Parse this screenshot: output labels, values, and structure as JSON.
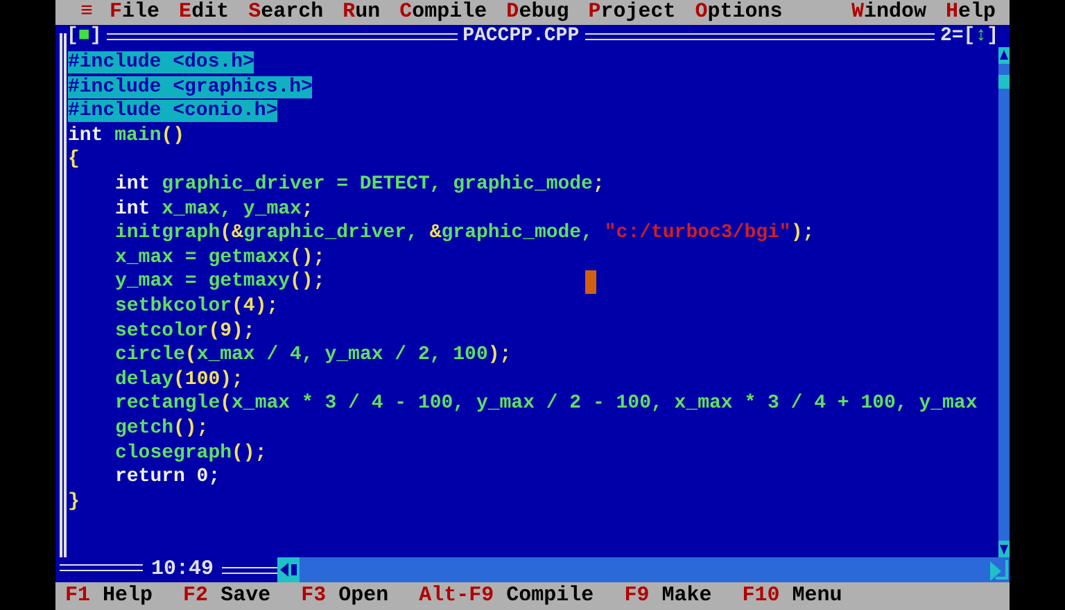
{
  "menu": {
    "system": "≡",
    "items": [
      {
        "label": "File"
      },
      {
        "label": "Edit"
      },
      {
        "label": "Search"
      },
      {
        "label": "Run"
      },
      {
        "label": "Compile"
      },
      {
        "label": "Debug"
      },
      {
        "label": "Project"
      },
      {
        "label": "Options"
      }
    ],
    "right_items": [
      {
        "label": "Window"
      },
      {
        "label": "Help"
      }
    ]
  },
  "editor": {
    "close_box": "[■]",
    "title": "PACCPP.CPP",
    "window_number": "2=",
    "zoom_box": "[↕]",
    "position": "10:49",
    "lines": [
      {
        "selected": true,
        "tokens": [
          {
            "kind": "selected",
            "text": "#include <dos.h>"
          }
        ]
      },
      {
        "selected": true,
        "tokens": [
          {
            "kind": "selected",
            "text": "#include <graphics.h>"
          }
        ]
      },
      {
        "selected": true,
        "tokens": [
          {
            "kind": "selected",
            "text": "#include <conio.h>"
          }
        ]
      },
      {
        "selected": false,
        "tokens": [
          {
            "kind": "keyword",
            "text": "int "
          },
          {
            "kind": "ident",
            "text": "main"
          },
          {
            "kind": "symbol",
            "text": "()"
          }
        ]
      },
      {
        "selected": false,
        "tokens": [
          {
            "kind": "symbol",
            "text": "{"
          }
        ],
        "children": [
          {
            "selected": false,
            "tokens": [
              {
                "kind": "keyword",
                "text": "int "
              },
              {
                "kind": "ident",
                "text": "graphic_driver = DETECT, graphic_mode"
              },
              {
                "kind": "symbol",
                "text": ";"
              }
            ]
          },
          {
            "selected": false,
            "tokens": [
              {
                "kind": "keyword",
                "text": "int "
              },
              {
                "kind": "ident",
                "text": "x_max, y_max"
              },
              {
                "kind": "symbol",
                "text": ";"
              }
            ]
          },
          {
            "selected": false,
            "tokens": [
              {
                "kind": "ident",
                "text": "initgraph"
              },
              {
                "kind": "symbol",
                "text": "(&"
              },
              {
                "kind": "ident",
                "text": "graphic_driver, "
              },
              {
                "kind": "symbol",
                "text": "&"
              },
              {
                "kind": "ident",
                "text": "graphic_mode, "
              },
              {
                "kind": "string",
                "text": "\"c:/turboc3/bgi\""
              },
              {
                "kind": "symbol",
                "text": ");"
              }
            ]
          },
          {
            "selected": false,
            "tokens": [
              {
                "kind": "ident",
                "text": "x_max = getmaxx"
              },
              {
                "kind": "symbol",
                "text": "();"
              }
            ]
          },
          {
            "selected": false,
            "tokens": [
              {
                "kind": "ident",
                "text": "y_max = getmaxy"
              },
              {
                "kind": "symbol",
                "text": "();"
              }
            ]
          },
          {
            "selected": false,
            "tokens": [
              {
                "kind": "ident",
                "text": "setbkcolor"
              },
              {
                "kind": "symbol",
                "text": "(4);"
              }
            ]
          },
          {
            "selected": false,
            "tokens": [
              {
                "kind": "ident",
                "text": "setcolor"
              },
              {
                "kind": "symbol",
                "text": "(9);"
              }
            ]
          },
          {
            "selected": false,
            "tokens": [
              {
                "kind": "ident",
                "text": "circle"
              },
              {
                "kind": "symbol",
                "text": "("
              },
              {
                "kind": "ident",
                "text": "x_max / 4, y_max / 2, 100"
              },
              {
                "kind": "symbol",
                "text": ");"
              }
            ]
          },
          {
            "selected": false,
            "tokens": [
              {
                "kind": "ident",
                "text": "delay"
              },
              {
                "kind": "symbol",
                "text": "(100);"
              }
            ]
          },
          {
            "selected": false,
            "tokens": [
              {
                "kind": "ident",
                "text": "rectangle"
              },
              {
                "kind": "symbol",
                "text": "("
              },
              {
                "kind": "ident",
                "text": "x_max * 3 / 4 - 100, y_max / 2 - 100, x_max * 3 / 4 + 100, y_max"
              }
            ]
          },
          {
            "selected": false,
            "tokens": [
              {
                "kind": "ident",
                "text": "getch"
              },
              {
                "kind": "symbol",
                "text": "();"
              }
            ]
          },
          {
            "selected": false,
            "tokens": [
              {
                "kind": "ident",
                "text": "closegraph"
              },
              {
                "kind": "symbol",
                "text": "();"
              }
            ]
          },
          {
            "selected": false,
            "tokens": [
              {
                "kind": "keyword",
                "text": "return 0;"
              }
            ]
          }
        ]
      },
      {
        "selected": false,
        "tokens": [
          {
            "kind": "symbol",
            "text": "}"
          }
        ]
      }
    ]
  },
  "status_bar": [
    {
      "key": "F1",
      "label": "Help"
    },
    {
      "key": "F2",
      "label": "Save"
    },
    {
      "key": "F3",
      "label": "Open"
    },
    {
      "key": "Alt-F9",
      "label": "Compile"
    },
    {
      "key": "F9",
      "label": "Make"
    },
    {
      "key": "F10",
      "label": "Menu"
    }
  ]
}
